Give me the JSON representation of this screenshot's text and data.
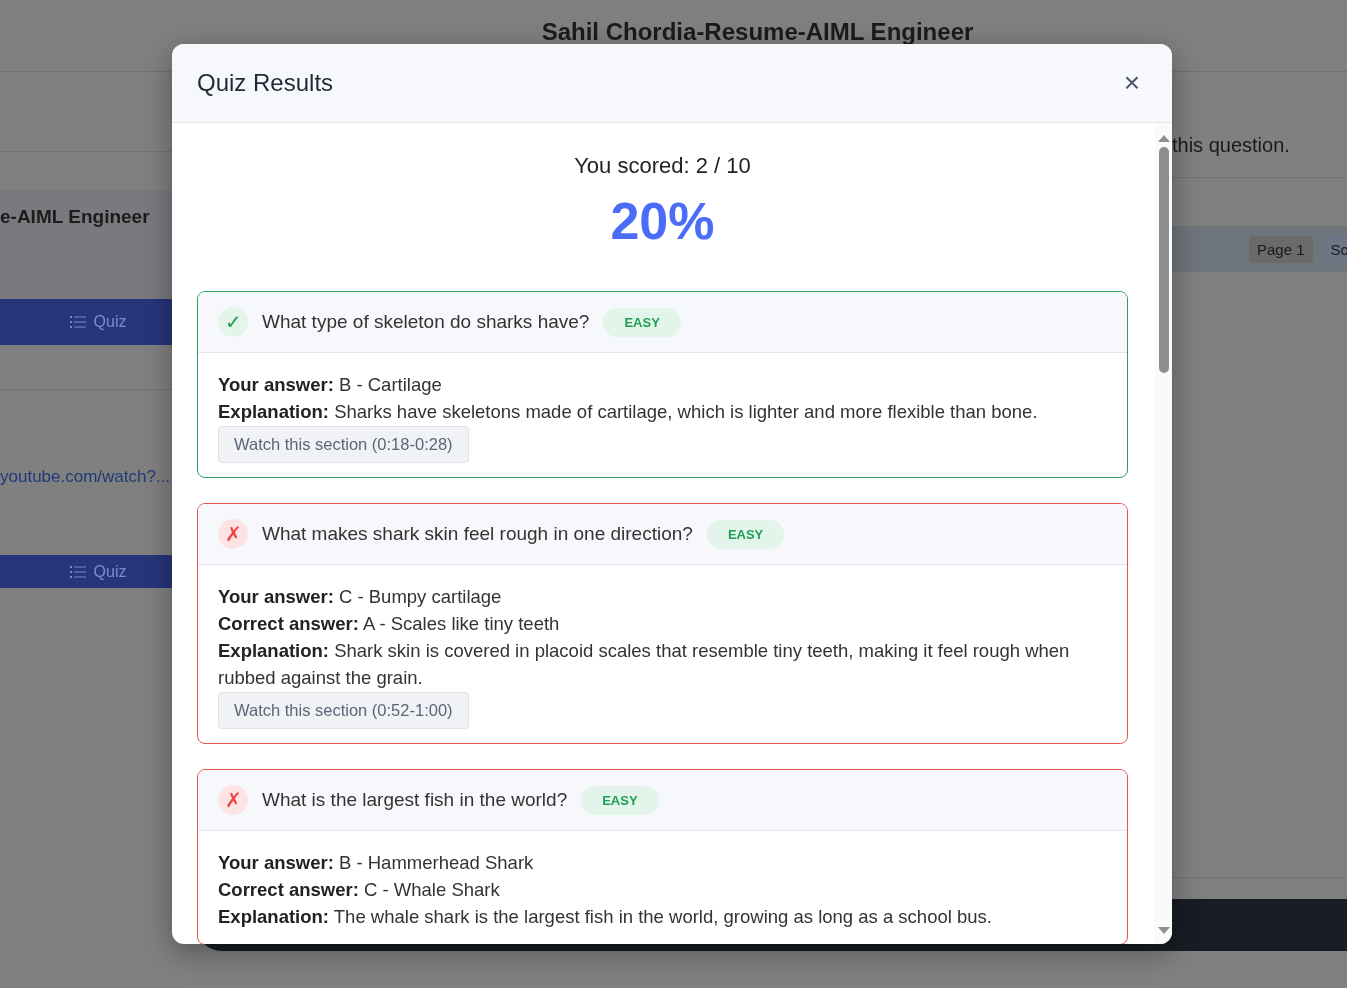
{
  "page": {
    "title": "Sahil Chordia-Resume-AIML Engineer",
    "left": {
      "card_title": "e-AIML Engineer",
      "quiz_buttons": [
        "Quiz",
        "Quiz"
      ],
      "link": "youtube.com/watch?..."
    },
    "right": {
      "text": "this question.",
      "chips": [
        "Page 1",
        "Sc"
      ]
    }
  },
  "modal": {
    "title": "Quiz Results",
    "close": "×",
    "score": "You scored: 2 / 10",
    "percent": "20%",
    "questions": [
      {
        "question": "What type of skeleton do sharks have?",
        "correct": true,
        "mark": "✓",
        "difficulty": "EASY",
        "lines": [
          "**Your answer:** B - Cartilage",
          "**Explanation:** Sharks have skeletons made of cartilage, which is lighter and more flexible than bone."
        ],
        "watch": "Watch this section (0:18-0:28)"
      },
      {
        "question": "What makes shark skin feel rough in one direction?",
        "correct": false,
        "mark": "✗",
        "difficulty": "EASY",
        "lines": [
          "**Your answer:** C - Bumpy cartilage",
          "**Correct answer:** A - Scales like tiny teeth",
          "**Explanation:** Shark skin is covered in placoid scales that resemble tiny teeth, making it feel rough when rubbed against the grain."
        ],
        "watch": "Watch this section (0:52-1:00)"
      },
      {
        "question": "What is the largest fish in the world?",
        "correct": false,
        "mark": "✗",
        "difficulty": "EASY",
        "lines": [
          "**Your answer:** B - Hammerhead Shark",
          "**Correct answer:** C - Whale Shark",
          "**Explanation:** The whale shark is the largest fish in the world, growing as long as a school bus."
        ]
      }
    ]
  }
}
